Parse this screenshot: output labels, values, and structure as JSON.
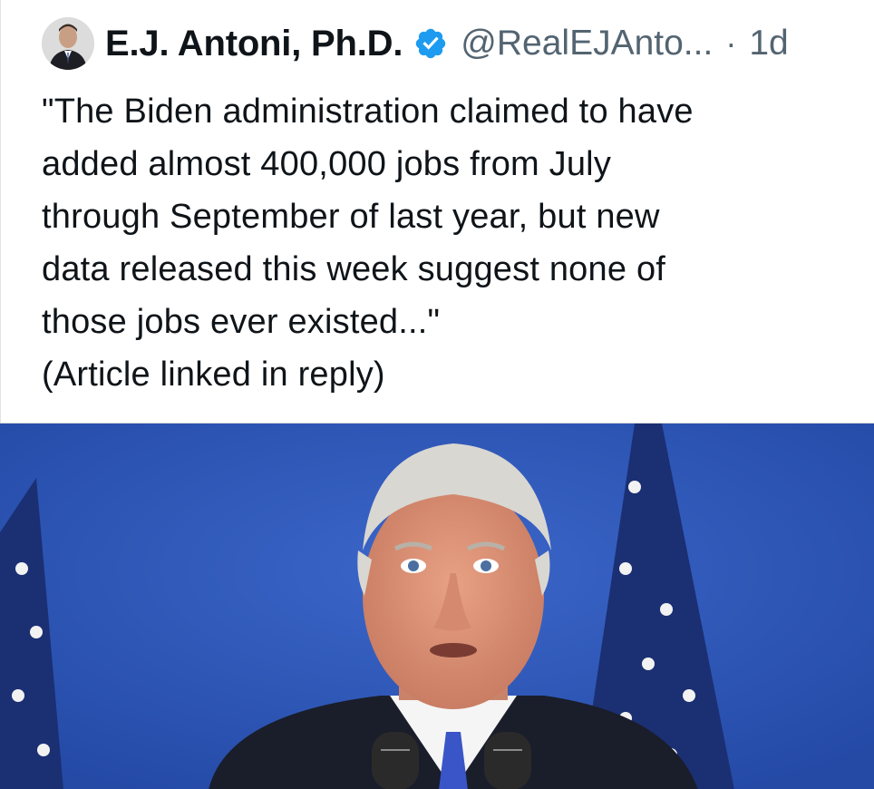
{
  "post": {
    "author_name": "E.J. Antoni, Ph.D.",
    "handle": "@RealEJAnto...",
    "separator": "·",
    "time": "1d",
    "verified_icon": "verified-badge-icon",
    "verified_color": "#1d9bf0",
    "text": "\"The Biden administration claimed to have\nadded almost 400,000 jobs from July\nthrough September of last year, but new\ndata released this week suggest none of\nthose jobs ever existed...\"\n(Article linked in reply)"
  },
  "media": {
    "image_label": "",
    "background_color": "#2e55b8"
  }
}
